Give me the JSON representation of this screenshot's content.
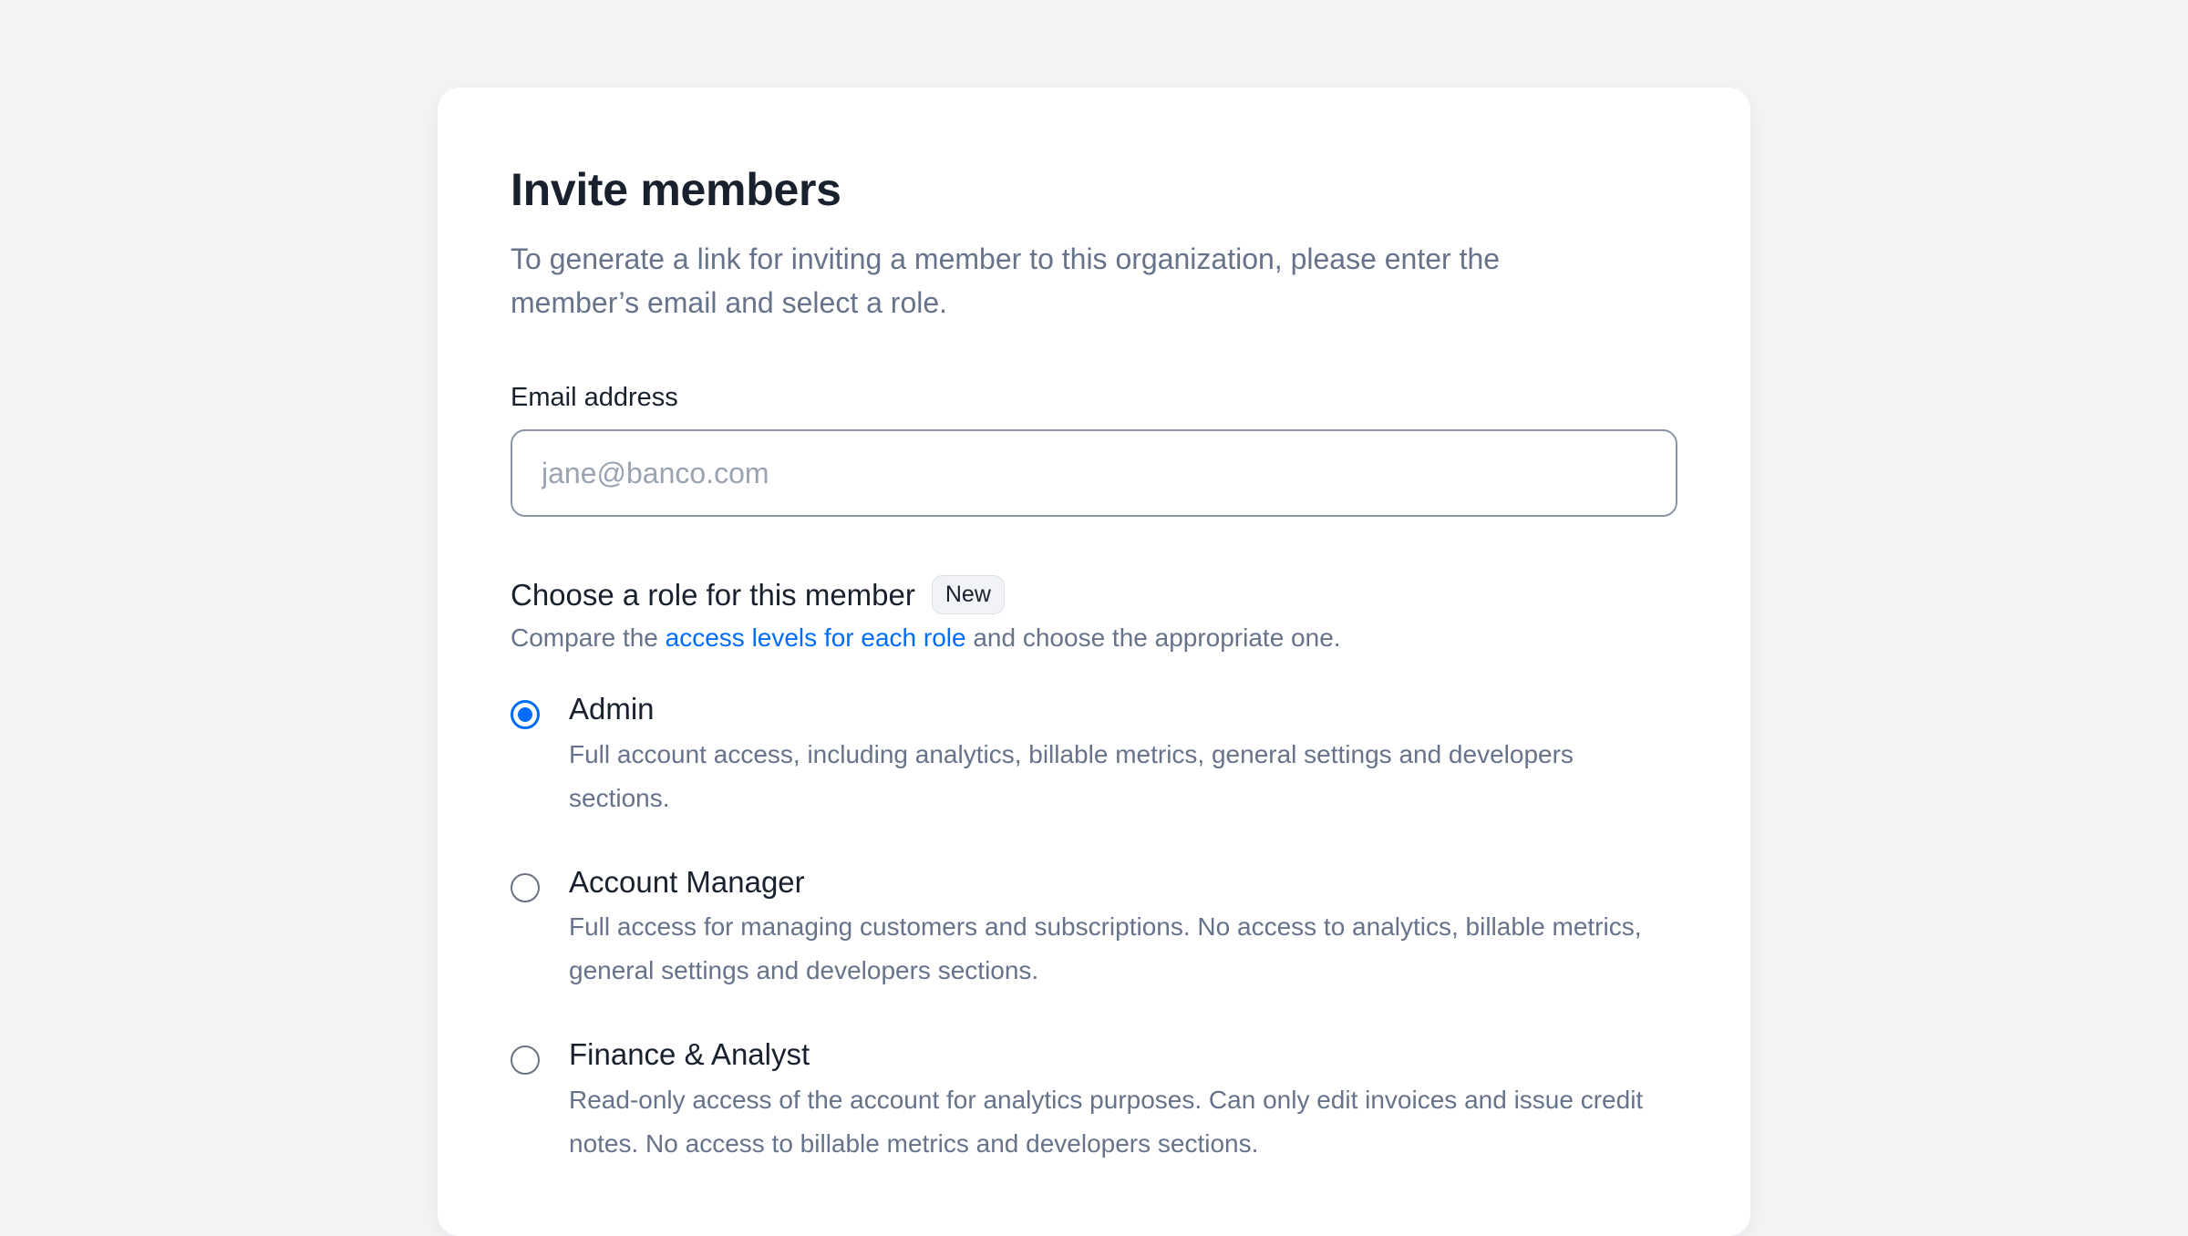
{
  "header": {
    "title": "Invite members",
    "subtitle": "To generate a link for inviting a member to this organization, please enter the member’s email and select a role."
  },
  "email": {
    "label": "Email address",
    "placeholder": "jane@banco.com",
    "value": ""
  },
  "roles_section": {
    "heading": "Choose a role for this member",
    "badge": "New",
    "hint_prefix": "Compare the ",
    "hint_link": "access levels for each role",
    "hint_suffix": " and choose the appropriate one."
  },
  "roles": [
    {
      "name": "Admin",
      "description": "Full account access, including analytics, billable metrics, general settings and developers sections.",
      "selected": true
    },
    {
      "name": "Account Manager",
      "description": "Full access for managing customers and subscriptions. No access to analytics, billable metrics, general settings and developers sections.",
      "selected": false
    },
    {
      "name": "Finance & Analyst",
      "description": "Read-only access of the account for analytics purposes. Can only edit invoices and issue credit notes. No access to billable metrics and developers sections.",
      "selected": false
    }
  ],
  "colors": {
    "accent": "#006cfa",
    "text_primary": "#19212e",
    "text_secondary": "#66738a",
    "background": "#f3f4f6"
  }
}
